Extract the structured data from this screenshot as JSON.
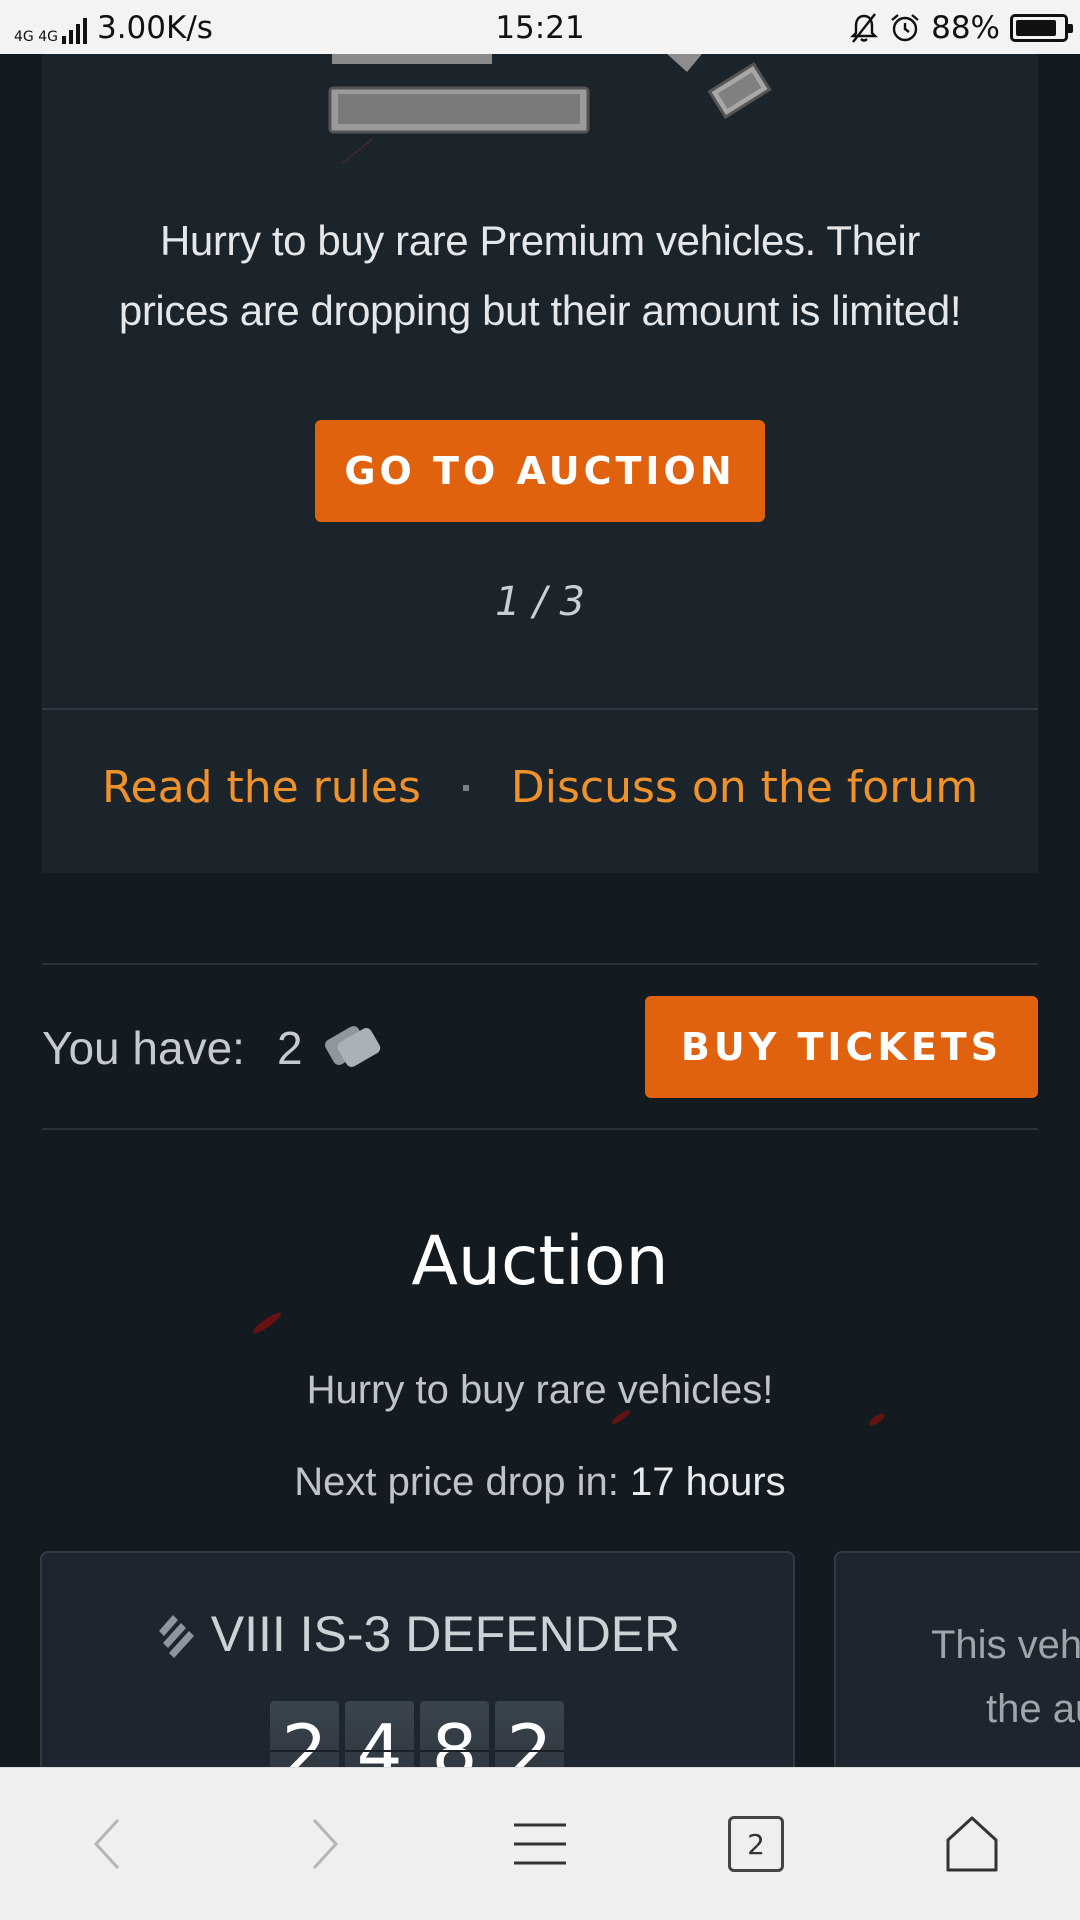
{
  "status_bar": {
    "network": "4G 4G",
    "speed": "3.00K/s",
    "time": "15:21",
    "battery_pct": "88%",
    "battery_level": 0.88
  },
  "banner": {
    "promo_text": "Hurry to buy rare Premium vehicles. Their prices are dropping but their amount is limited!",
    "cta_label": "GO TO AUCTION",
    "pager": "1 / 3",
    "links": {
      "rules": "Read the rules",
      "forum": "Discuss on the forum"
    }
  },
  "tickets": {
    "label": "You have:",
    "count": "2",
    "icon": "ticket-icon",
    "buy_label": "BUY TICKETS"
  },
  "auction": {
    "title": "Auction",
    "subtitle": "Hurry to buy rare vehicles!",
    "price_drop_label": "Next price drop in:",
    "price_drop_value": "17 hours"
  },
  "vehicle_card": {
    "name": "VIII IS-3 DEFENDER",
    "price_digits": [
      "2",
      "4",
      "8",
      "2"
    ]
  },
  "next_card": {
    "line1": "This veh",
    "line2": "the au"
  },
  "bottom_nav": {
    "tabs_count": "2"
  },
  "colors": {
    "accent": "#e0620f",
    "link": "#f0922a",
    "background": "#131a20",
    "card": "#1b232b"
  }
}
